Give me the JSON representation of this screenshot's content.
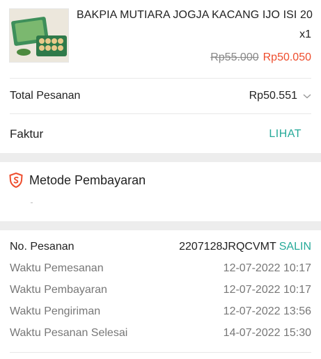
{
  "product": {
    "name": "BAKPIA MUTIARA JOGJA KACANG IJO ISI 20",
    "quantity": "x1",
    "original_price": "Rp55.000",
    "price": "Rp50.050"
  },
  "total": {
    "label": "Total Pesanan",
    "value": "Rp50.551"
  },
  "faktur": {
    "label": "Faktur",
    "action": "LIHAT"
  },
  "payment": {
    "title": "Metode Pembayaran"
  },
  "order_details": {
    "order_no": {
      "label": "No. Pesanan",
      "value": "2207128JRQCVMT",
      "action": "SALIN"
    },
    "rows": [
      {
        "label": "Waktu Pemesanan",
        "value": "12-07-2022 10:17"
      },
      {
        "label": "Waktu Pembayaran",
        "value": "12-07-2022 10:17"
      },
      {
        "label": "Waktu Pengiriman",
        "value": "12-07-2022 13:56"
      },
      {
        "label": "Waktu Pesanan Selesai",
        "value": "14-07-2022 15:30"
      }
    ]
  },
  "colors": {
    "accent_teal": "#26aa99",
    "price_orange": "#ee4d2d",
    "shield_icon": "#ee4d2d"
  },
  "icons": {
    "total_toggle": "chevron-down-icon",
    "payment": "shield-icon"
  }
}
